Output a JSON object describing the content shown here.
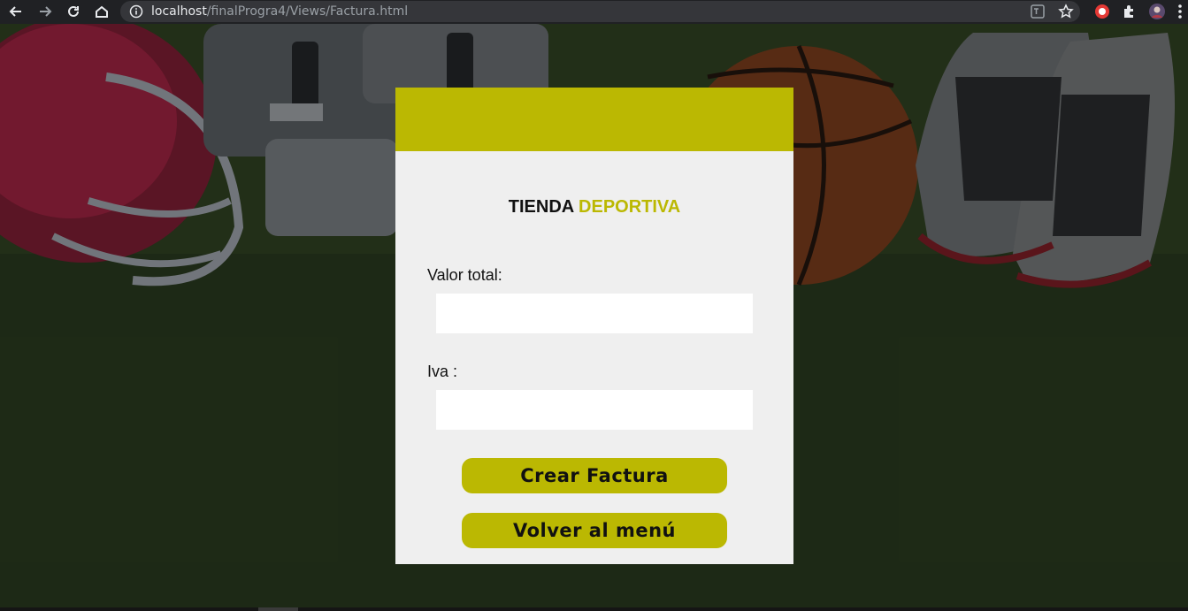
{
  "browser": {
    "url_host": "localhost",
    "url_path": "/finalProgra4/Views/Factura.html",
    "icons": [
      "back-icon",
      "forward-icon",
      "reload-icon",
      "home-icon",
      "info-icon",
      "translate-icon",
      "star-icon",
      "extension-icon",
      "puzzle-icon",
      "profile-avatar",
      "menu-icon"
    ]
  },
  "card": {
    "brand_primary": "TIENDA",
    "brand_secondary": "DEPORTIVA",
    "fields": [
      {
        "label": "Valor total:",
        "value": ""
      },
      {
        "label": "Iva :",
        "value": ""
      }
    ],
    "buttons": {
      "create": "Crear Factura",
      "back": "Volver al menú"
    }
  },
  "colors": {
    "accent": "#bbb802",
    "card_bg": "#efefef",
    "toolbar_bg": "#202124"
  }
}
